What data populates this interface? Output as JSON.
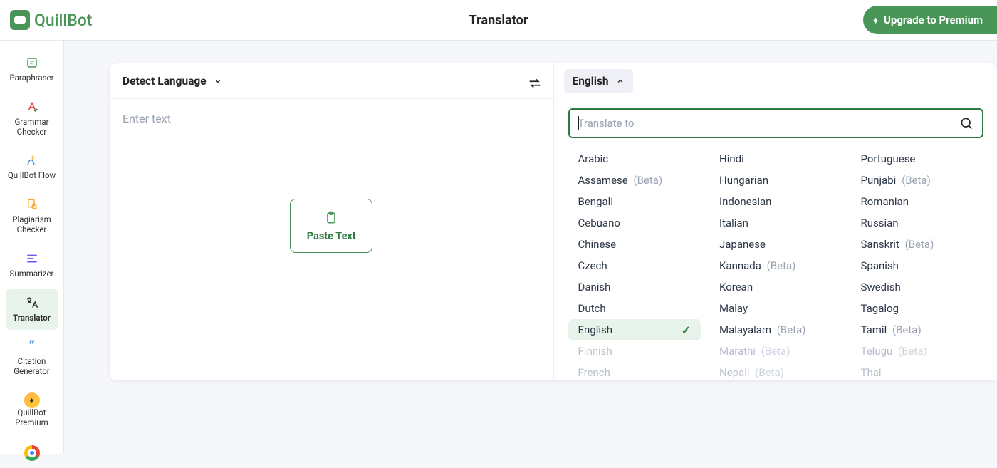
{
  "header": {
    "brand": "QuillBot",
    "title": "Translator",
    "premium_label": "Upgrade to Premium"
  },
  "sidebar": {
    "items": [
      {
        "label": "Paraphraser"
      },
      {
        "label": "Grammar Checker"
      },
      {
        "label": "QuillBot Flow"
      },
      {
        "label": "Plagiarism Checker"
      },
      {
        "label": "Summarizer"
      },
      {
        "label": "Translator"
      },
      {
        "label": "Citation Generator"
      },
      {
        "label": "QuillBot Premium"
      }
    ]
  },
  "source": {
    "button": "Detect Language",
    "placeholder": "Enter text",
    "paste_label": "Paste Text"
  },
  "target": {
    "button": "English",
    "search_placeholder": "Translate to",
    "columns": [
      [
        {
          "name": "Arabic"
        },
        {
          "name": "Assamese",
          "beta": "(Beta)"
        },
        {
          "name": "Bengali"
        },
        {
          "name": "Cebuano"
        },
        {
          "name": "Chinese"
        },
        {
          "name": "Czech"
        },
        {
          "name": "Danish"
        },
        {
          "name": "Dutch"
        },
        {
          "name": "English",
          "selected": true
        },
        {
          "name": "Finnish",
          "faded": true
        },
        {
          "name": "French",
          "faded": true
        }
      ],
      [
        {
          "name": "Hindi"
        },
        {
          "name": "Hungarian"
        },
        {
          "name": "Indonesian"
        },
        {
          "name": "Italian"
        },
        {
          "name": "Japanese"
        },
        {
          "name": "Kannada",
          "beta": "(Beta)"
        },
        {
          "name": "Korean"
        },
        {
          "name": "Malay"
        },
        {
          "name": "Malayalam",
          "beta": "(Beta)"
        },
        {
          "name": "Marathi",
          "beta": "(Beta)",
          "faded": true
        },
        {
          "name": "Nepali",
          "beta": "(Beta)",
          "faded": true
        }
      ],
      [
        {
          "name": "Portuguese"
        },
        {
          "name": "Punjabi",
          "beta": "(Beta)"
        },
        {
          "name": "Romanian"
        },
        {
          "name": "Russian"
        },
        {
          "name": "Sanskrit",
          "beta": "(Beta)"
        },
        {
          "name": "Spanish"
        },
        {
          "name": "Swedish"
        },
        {
          "name": "Tagalog"
        },
        {
          "name": "Tamil",
          "beta": "(Beta)"
        },
        {
          "name": "Telugu",
          "beta": "(Beta)",
          "faded": true
        },
        {
          "name": "Thai",
          "faded": true
        }
      ]
    ]
  }
}
